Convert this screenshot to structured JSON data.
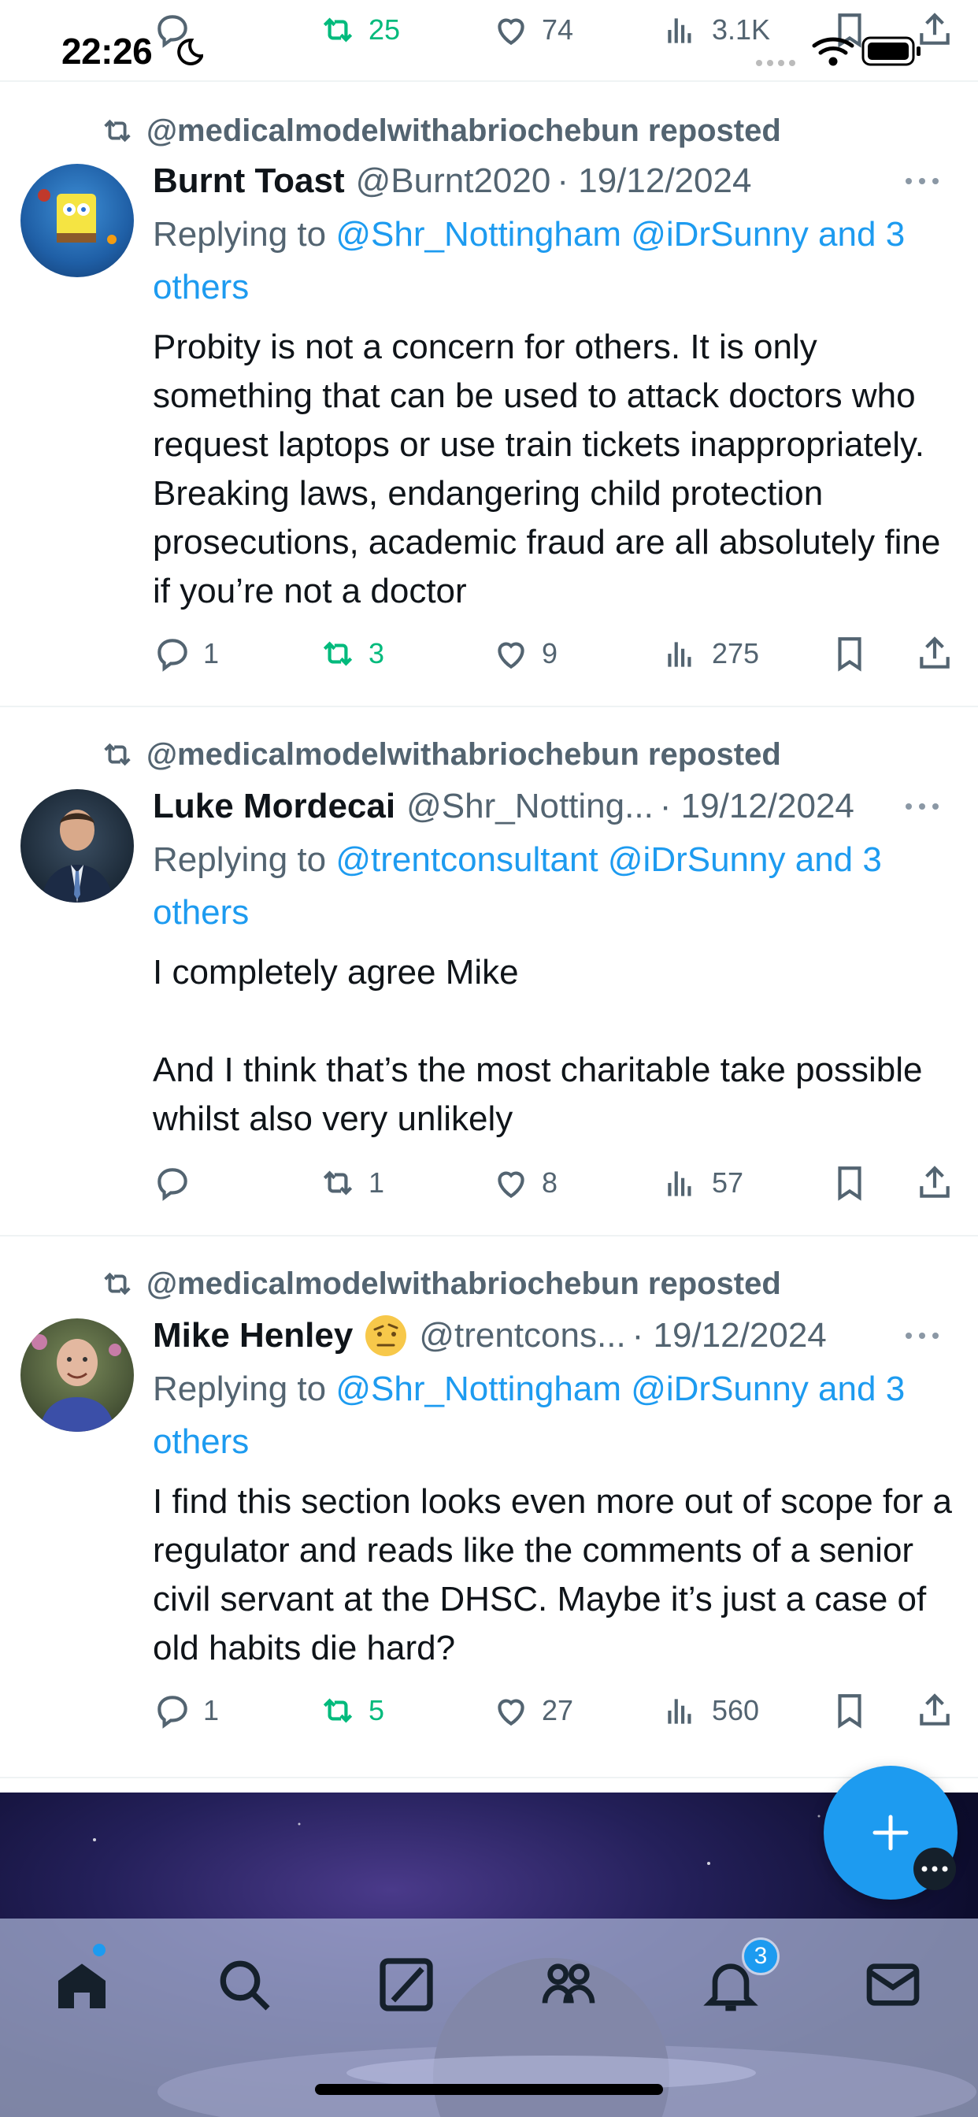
{
  "status_bar": {
    "time": "22:26"
  },
  "prev_tweet_actions": {
    "retweets": "25",
    "likes": "74",
    "views": "3.1K"
  },
  "tweets": [
    {
      "reposted_by": "@medicalmodelwithabriochebun reposted",
      "name": "Burnt Toast",
      "handle": "@Burnt2020",
      "date": "· 19/12/2024",
      "replying_prefix": "Replying to ",
      "replying_links": "@Shr_Nottingham @iDrSunny and 3 others",
      "text": "Probity is not a concern for others. It is only something that can be used to attack doctors who request laptops or use train tickets inappropriately. Breaking laws, endangering child protection prosecutions, academic fraud are all absolutely fine if you’re not a doctor",
      "replies": "1",
      "retweets": "3",
      "likes": "9",
      "views": "275",
      "retweeted": true
    },
    {
      "reposted_by": "@medicalmodelwithabriochebun reposted",
      "name": "Luke Mordecai",
      "handle": "@Shr_Notting...",
      "date": "· 19/12/2024",
      "replying_prefix": "Replying to ",
      "replying_links": "@trentconsultant @iDrSunny and 3 others",
      "text": "I completely agree Mike\n\nAnd I think that’s the most charitable take possible whilst also very unlikely",
      "replies": "",
      "retweets": "1",
      "likes": "8",
      "views": "57",
      "retweeted": false
    },
    {
      "reposted_by": "@medicalmodelwithabriochebun reposted",
      "name": "Mike Henley",
      "handle": "@trentcons...",
      "date": "· 19/12/2024",
      "replying_prefix": "Replying to ",
      "replying_links": "@Shr_Nottingham @iDrSunny and 3 others",
      "text": "I find this section looks even more out of scope for a regulator and reads like the comments of a senior civil servant at the DHSC. Maybe it’s just a case of old habits die hard?",
      "replies": "1",
      "retweets": "5",
      "likes": "27",
      "views": "560",
      "retweeted": true
    }
  ],
  "nav": {
    "notifications_badge": "3"
  },
  "colors": {
    "accent": "#1d9bf0",
    "retweet_green": "#00ba7c",
    "muted": "#536471"
  },
  "icons": [
    "reply-icon",
    "retweet-icon",
    "like-icon",
    "views-icon",
    "bookmark-icon",
    "share-icon",
    "home-icon",
    "search-icon",
    "grok-icon",
    "communities-icon",
    "notifications-icon",
    "messages-icon",
    "compose-plus-icon"
  ]
}
